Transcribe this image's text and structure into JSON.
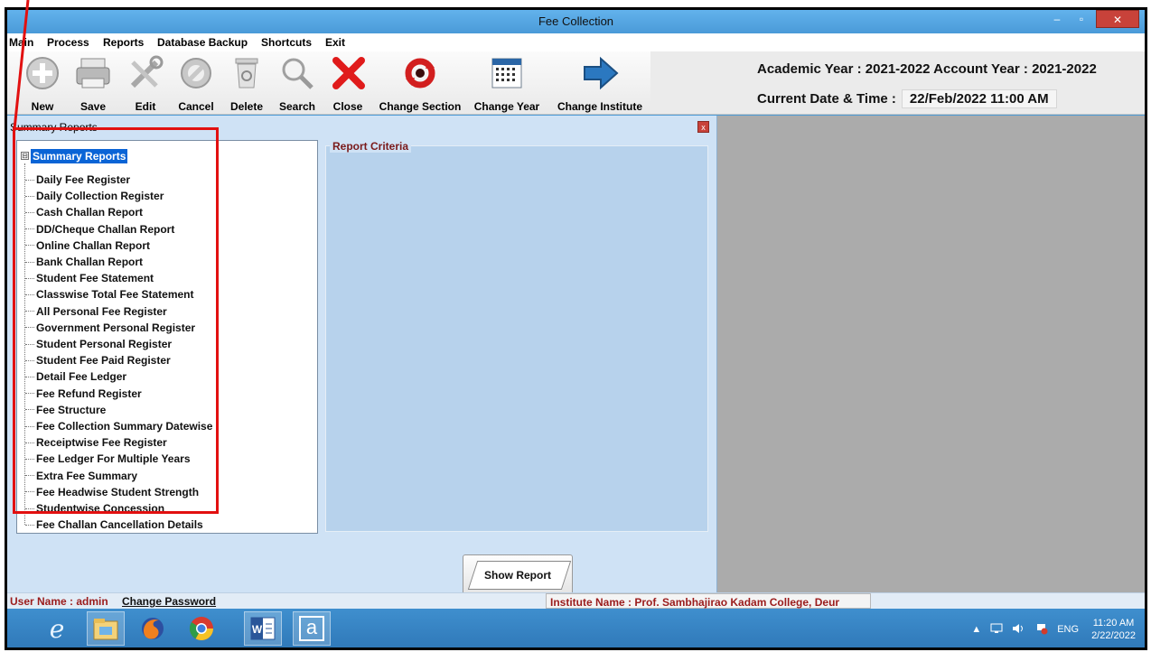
{
  "window": {
    "title": "Fee Collection",
    "minimize": "–",
    "maximize": "▫",
    "close": "✕"
  },
  "menu": [
    "Main",
    "Process",
    "Reports",
    "Database Backup",
    "Shortcuts",
    "Exit"
  ],
  "toolbar": [
    {
      "label": "New",
      "icon": "plus-circle-icon"
    },
    {
      "label": "Save",
      "icon": "printer-icon"
    },
    {
      "label": "Edit",
      "icon": "tools-icon"
    },
    {
      "label": "Cancel",
      "icon": "cancel-icon"
    },
    {
      "label": "Delete",
      "icon": "recycle-bin-icon"
    },
    {
      "label": "Search",
      "icon": "magnifier-icon"
    },
    {
      "label": "Close",
      "icon": "red-x-icon"
    },
    {
      "label": "Change Section",
      "icon": "refresh-icon"
    },
    {
      "label": "Change Year",
      "icon": "calendar-icon"
    },
    {
      "label": "Change Institute",
      "icon": "arrow-right-icon"
    }
  ],
  "header": {
    "years": "Academic Year : 2021-2022 Account Year : 2021-2022",
    "datetime_label": "Current Date & Time :",
    "datetime_value": "22/Feb/2022 11:00 AM"
  },
  "panel": {
    "title": "Summary Reports",
    "close": "x",
    "tree_root": "Summary Reports",
    "tree_root_toggle": "⊟",
    "items": [
      "Daily Fee Register",
      "Daily Collection Register",
      "Cash Challan Report",
      "DD/Cheque Challan Report",
      "Online Challan Report",
      "Bank Challan Report",
      "Student Fee Statement",
      "Classwise Total Fee Statement",
      "All Personal Fee Register",
      "Government Personal Register",
      "Student Personal Register",
      "Student Fee Paid Register",
      "Detail Fee Ledger",
      "Fee Refund Register",
      "Fee Structure",
      "Fee Collection Summary Datewise",
      "Receiptwise Fee Register",
      "Fee Ledger For Multiple Years",
      "Extra Fee Summary",
      "Fee Headwise Student Strength",
      "Studentwise Concession",
      "Fee Challan Cancellation Details"
    ],
    "criteria_label": "Report Criteria",
    "show_report": "Show Report"
  },
  "status": {
    "user": "User Name : admin",
    "change_password": "Change Password",
    "institute": "Institute Name : Prof. Sambhajirao Kadam College, Deur"
  },
  "taskbar": {
    "apps": [
      "internet-explorer-icon",
      "file-explorer-icon",
      "firefox-icon",
      "chrome-icon",
      "word-icon",
      "app-a-icon"
    ],
    "app_a_letter": "a",
    "word_letter": "W",
    "tray_chevron": "▲",
    "lang": "ENG",
    "time": "11:20 AM",
    "date": "2/22/2022"
  },
  "colors": {
    "accent": "#4a9ad8",
    "panel_bg": "#cfe2f5",
    "criteria_bg": "#b7d2ec",
    "status_red": "#9b1c1c",
    "annotation_red": "#e21010",
    "tree_selected": "#0a64d6"
  }
}
